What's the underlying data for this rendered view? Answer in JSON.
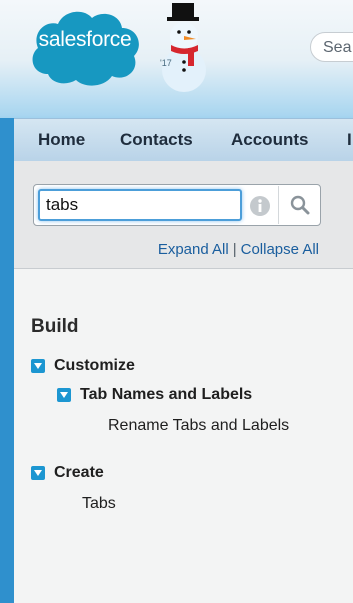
{
  "header": {
    "logo_text": "salesforce",
    "snowman_year": "'17",
    "search_placeholder": "Sea"
  },
  "tabs": [
    {
      "label": "Home"
    },
    {
      "label": "Contacts"
    },
    {
      "label": "Accounts"
    },
    {
      "label": "I"
    }
  ],
  "quick_find": {
    "value": "tabs",
    "expand_all": "Expand All",
    "separator": "|",
    "collapse_all": "Collapse All"
  },
  "tree": {
    "section_title": "Build",
    "customize": {
      "label": "Customize",
      "child": {
        "label": "Tab Names and Labels",
        "leaf": "Rename Tabs and Labels"
      }
    },
    "create": {
      "label": "Create",
      "leaf": "Tabs"
    }
  },
  "colors": {
    "brand": "#1798c1",
    "tab_bar": "#c8dced",
    "toggle": "#1c96d1",
    "link": "#1a5e9e"
  }
}
